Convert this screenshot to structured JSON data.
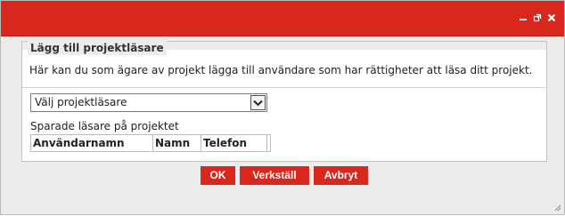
{
  "dialog": {
    "controls": [
      "minimize-icon",
      "restore-icon",
      "close-icon"
    ],
    "accent_color": "#d9271d"
  },
  "fieldset": {
    "legend": "Lägg till projektläsare",
    "description": "Här kan du som ägare av projekt lägga till användare som har rättigheter att läsa ditt projekt.",
    "select": {
      "value": "Välj projektläsare"
    },
    "saved_label": "Sparade läsare på projektet",
    "table": {
      "columns": [
        "Användarnamn",
        "Namn",
        "Telefon"
      ]
    }
  },
  "buttons": {
    "ok": "OK",
    "apply": "Verkställ",
    "cancel": "Avbryt"
  }
}
